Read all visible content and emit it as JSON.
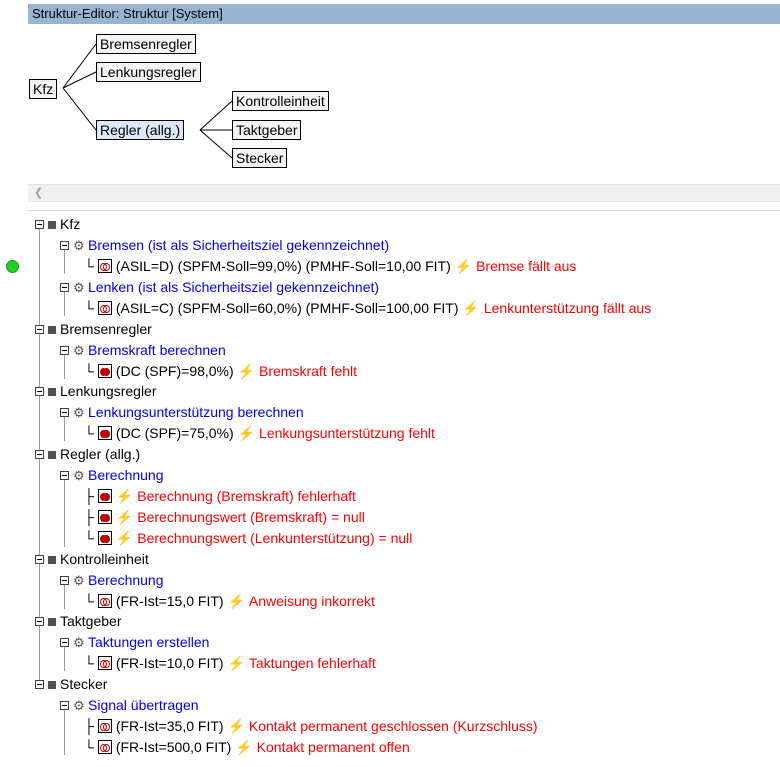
{
  "window": {
    "title": "Struktur-Editor: Struktur [System]"
  },
  "diagram": {
    "nodes": {
      "kfz": "Kfz",
      "bremsenregler": "Bremsenregler",
      "lenkungsregler": "Lenkungsregler",
      "regler": "Regler (allg.)",
      "kontrolleinheit": "Kontrolleinheit",
      "taktgeber": "Taktgeber",
      "stecker": "Stecker"
    }
  },
  "tree": {
    "kfz": {
      "label": "Kfz",
      "functions": [
        {
          "label": "Bremsen (ist als Sicherheitsziel gekennzeichnet)",
          "attrs": "(ASIL=D) (SPFM-Soll=99,0%) (PMHF-Soll=10,00 FIT)",
          "failure": "Bremse fällt aus"
        },
        {
          "label": "Lenken (ist als Sicherheitsziel gekennzeichnet)",
          "attrs": "(ASIL=C) (SPFM-Soll=60,0%) (PMHF-Soll=100,00 FIT)",
          "failure": "Lenkunterstützung fällt aus"
        }
      ]
    },
    "bremsenregler": {
      "label": "Bremsenregler",
      "function": "Bremskraft berechnen",
      "attrs": "(DC (SPF)=98,0%)",
      "failure": "Bremskraft fehlt"
    },
    "lenkungsregler": {
      "label": "Lenkungsregler",
      "function": "Lenkungsunterstützung berechnen",
      "attrs": "(DC (SPF)=75,0%)",
      "failure": "Lenkungsunterstützung fehlt"
    },
    "regler": {
      "label": "Regler (allg.)",
      "function": "Berechnung",
      "failures": [
        "Berechnung (Bremskraft) fehlerhaft",
        "Berechnungswert (Bremskraft) = null",
        "Berechnungswert (Lenkunterstützung) = null"
      ]
    },
    "kontrolleinheit": {
      "label": "Kontrolleinheit",
      "function": "Berechnung",
      "attrs": "(FR-Ist=15,0 FIT)",
      "failure": "Anweisung inkorrekt"
    },
    "taktgeber": {
      "label": "Taktgeber",
      "function": "Taktungen erstellen",
      "attrs": "(FR-Ist=10,0 FIT)",
      "failure": "Taktungen fehlerhaft"
    },
    "stecker": {
      "label": "Stecker",
      "function": "Signal übertragen",
      "items": [
        {
          "attrs": "(FR-Ist=35,0 FIT)",
          "failure": "Kontakt permanent geschlossen (Kurzschluss)"
        },
        {
          "attrs": "(FR-Ist=500,0 FIT)",
          "failure": "Kontakt permanent offen"
        }
      ]
    }
  },
  "icons": {
    "scroll_left": "chevron-left-icon",
    "status": "status-ok-icon",
    "function": "function-icon",
    "failure_mode": "failure-mode-icon",
    "failure": "lightning-icon"
  },
  "colors": {
    "title_bar": "#99b4d1",
    "function_text": "#0000ee",
    "failure_text": "#ff0000",
    "status_ok": "#22cc22"
  }
}
